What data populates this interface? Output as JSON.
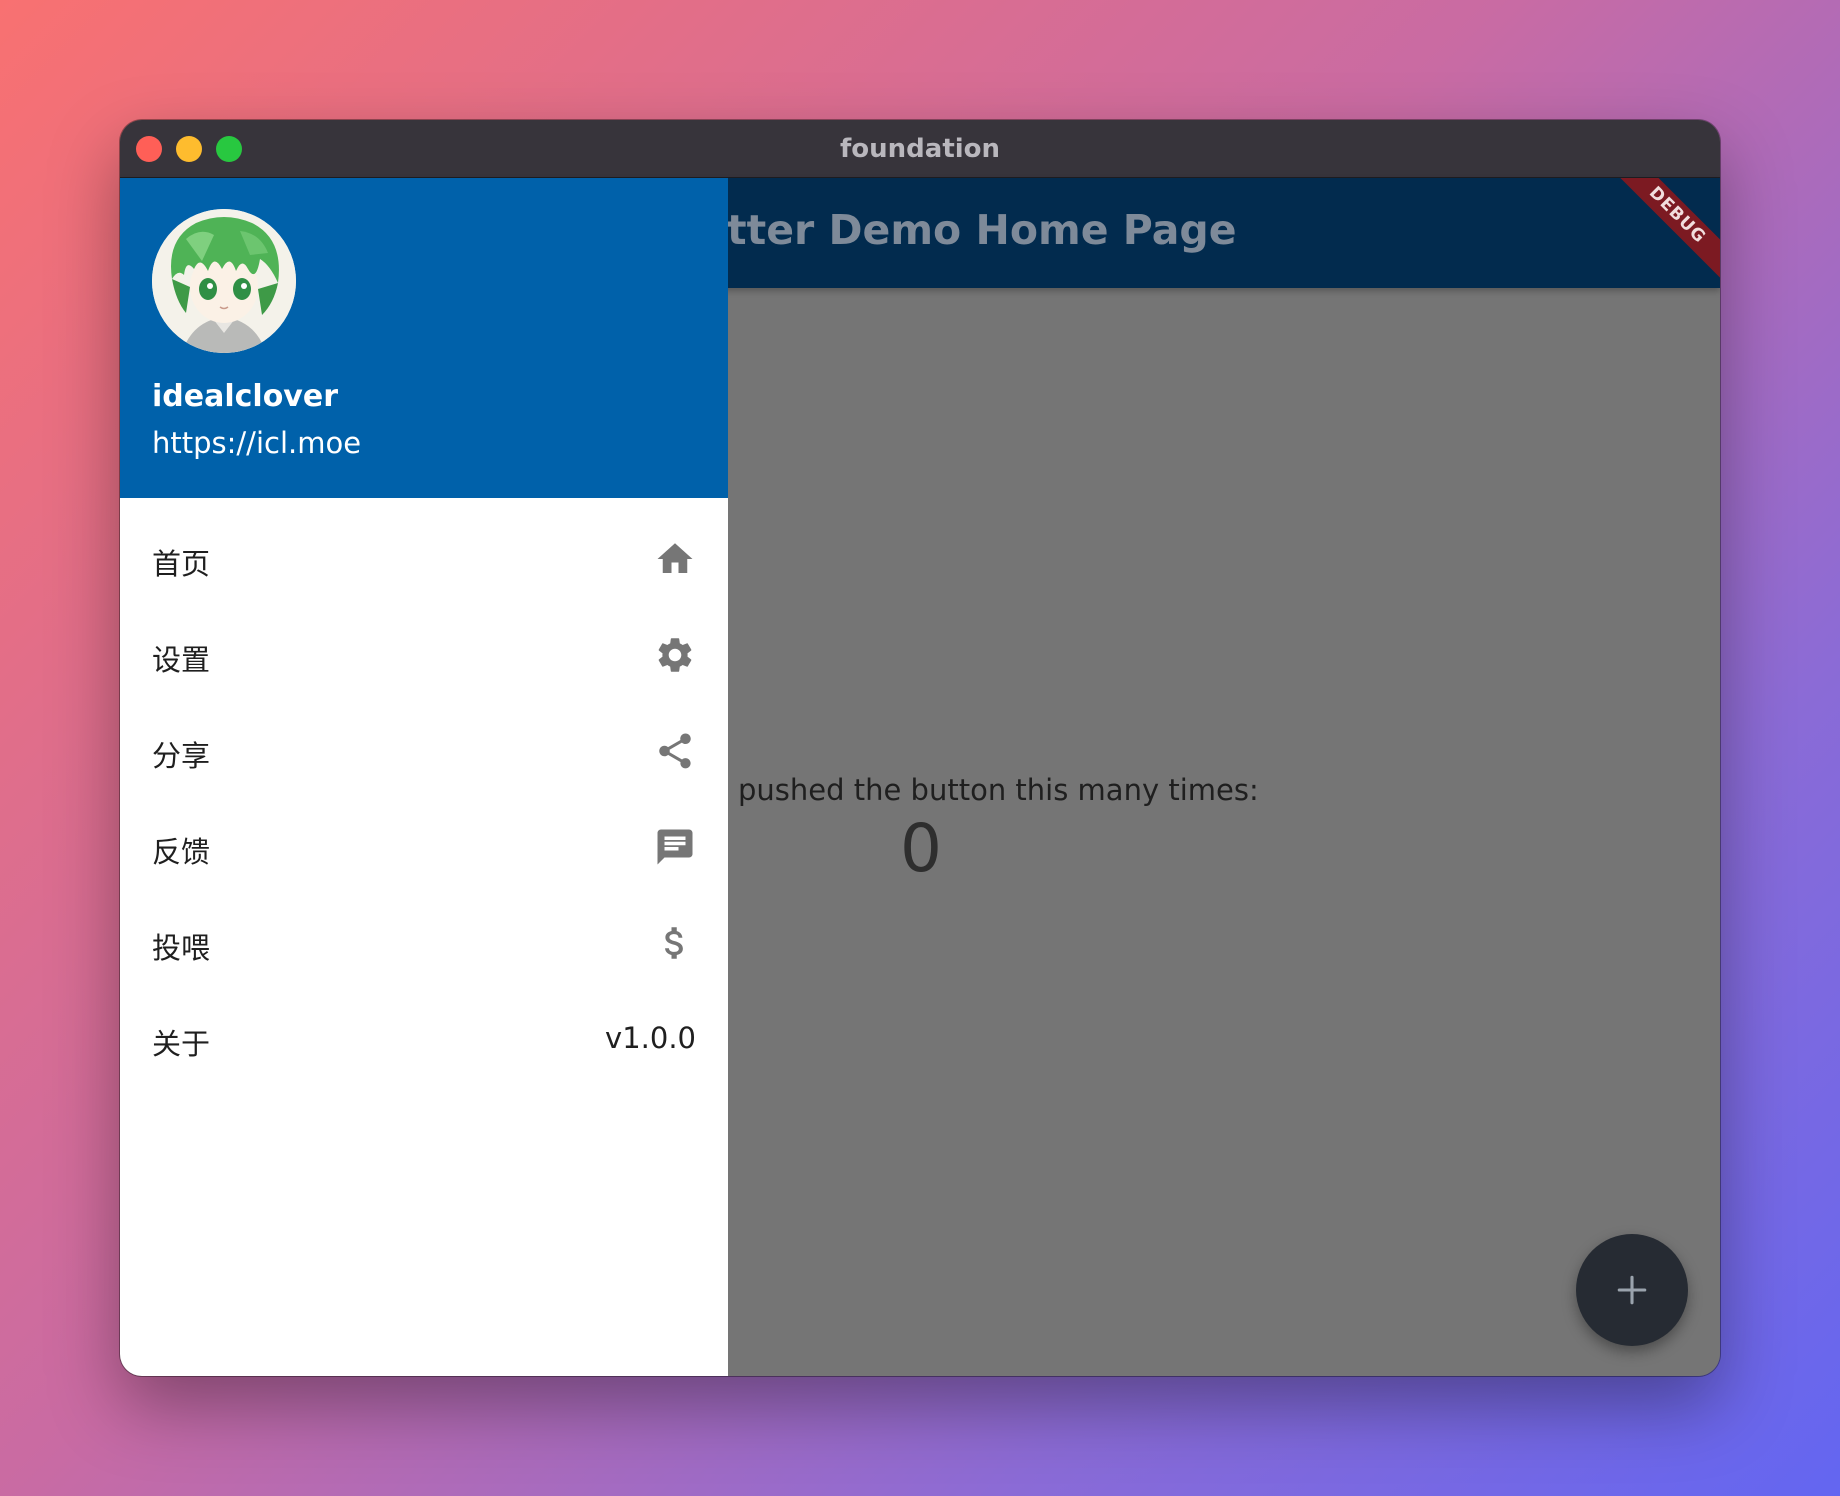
{
  "window": {
    "title": "foundation"
  },
  "app": {
    "title": "tter Demo Home Page",
    "debug_label": "DEBUG",
    "counter_label": "pushed the button this many times:",
    "counter_value": "0",
    "fab_icon": "plus-icon"
  },
  "drawer": {
    "header_color": "#0061aa",
    "avatar_icon": "anime-avatar",
    "user_name": "idealclover",
    "user_url": "https://icl.moe",
    "items": [
      {
        "label": "首页",
        "icon": "home-icon"
      },
      {
        "label": "设置",
        "icon": "gear-icon"
      },
      {
        "label": "分享",
        "icon": "share-icon"
      },
      {
        "label": "反馈",
        "icon": "message-icon"
      },
      {
        "label": "投喂",
        "icon": "dollar-icon"
      },
      {
        "label": "关于",
        "trailing_text": "v1.0.0"
      }
    ]
  },
  "colors": {
    "appbar": "#022b4e",
    "scrim": "#757575",
    "fab": "#262b33",
    "debug_ribbon": "#7c1a22"
  }
}
